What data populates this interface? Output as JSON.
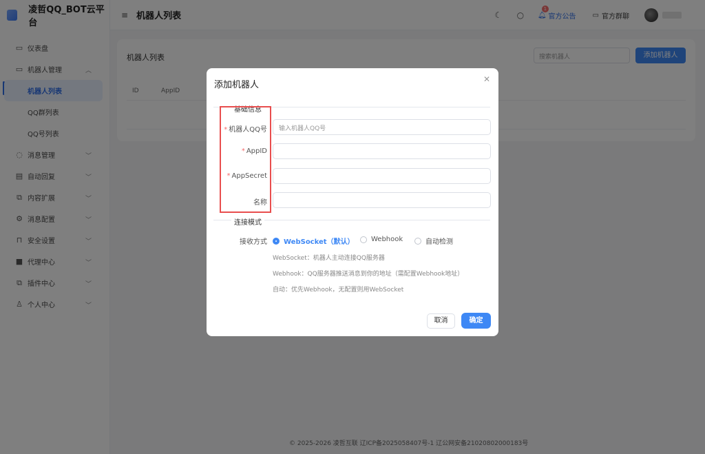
{
  "brand": {
    "name": "凌哲QQ_BOT云平台"
  },
  "header": {
    "title": "机器人列表",
    "notice_label": "官方公告",
    "notice_badge": "1",
    "group_label": "官方群聊"
  },
  "sidebar": {
    "items": [
      {
        "label": "仪表盘",
        "icon": "dashboard-icon"
      },
      {
        "label": "机器人管理",
        "icon": "monitor-icon",
        "expanded": true
      },
      {
        "label": "机器人列表",
        "active": true
      },
      {
        "label": "QQ群列表"
      },
      {
        "label": "QQ号列表"
      },
      {
        "label": "消息管理",
        "icon": "chat-icon"
      },
      {
        "label": "自动回复",
        "icon": "reply-icon"
      },
      {
        "label": "内容扩展",
        "icon": "extend-icon"
      },
      {
        "label": "消息配置",
        "icon": "gear-icon"
      },
      {
        "label": "安全设置",
        "icon": "lock-icon"
      },
      {
        "label": "代理中心",
        "icon": "proxy-icon"
      },
      {
        "label": "插件中心",
        "icon": "plugin-icon"
      },
      {
        "label": "个人中心",
        "icon": "user-icon"
      }
    ]
  },
  "main": {
    "card_title": "机器人列表",
    "search_placeholder": "搜索机器人",
    "add_button": "添加机器人",
    "table_headers": [
      "ID",
      "AppID"
    ]
  },
  "footer": {
    "text": "© 2025-2026 凌哲互联    辽ICP备2025058407号-1    辽公网安备21020802000183号"
  },
  "dialog": {
    "title": "添加机器人",
    "section_basic": "基础信息",
    "fields": [
      {
        "label": "机器人QQ号",
        "required": true,
        "placeholder": "输入机器人QQ号",
        "value": ""
      },
      {
        "label": "AppID",
        "required": true,
        "placeholder": "",
        "value": ""
      },
      {
        "label": "AppSecret",
        "required": true,
        "placeholder": "",
        "value": ""
      },
      {
        "label": "名称",
        "required": false,
        "placeholder": "",
        "value": ""
      }
    ],
    "section_connect": "连接模式",
    "receive_label": "接收方式",
    "options": [
      {
        "label": "WebSocket（默认）",
        "checked": true
      },
      {
        "label": "Webhook",
        "checked": false
      },
      {
        "label": "自动检测",
        "checked": false
      }
    ],
    "hints": [
      "WebSocket：机器人主动连接QQ服务器",
      "Webhook：QQ服务器推送消息到你的地址（需配置Webhook地址）",
      "自动：优先Webhook，无配置则用WebSocket"
    ],
    "cancel": "取消",
    "ok": "确定"
  },
  "colors": {
    "accent": "#3e88f5",
    "required": "#f56c6c",
    "highlight_box": "#e84d4d"
  }
}
